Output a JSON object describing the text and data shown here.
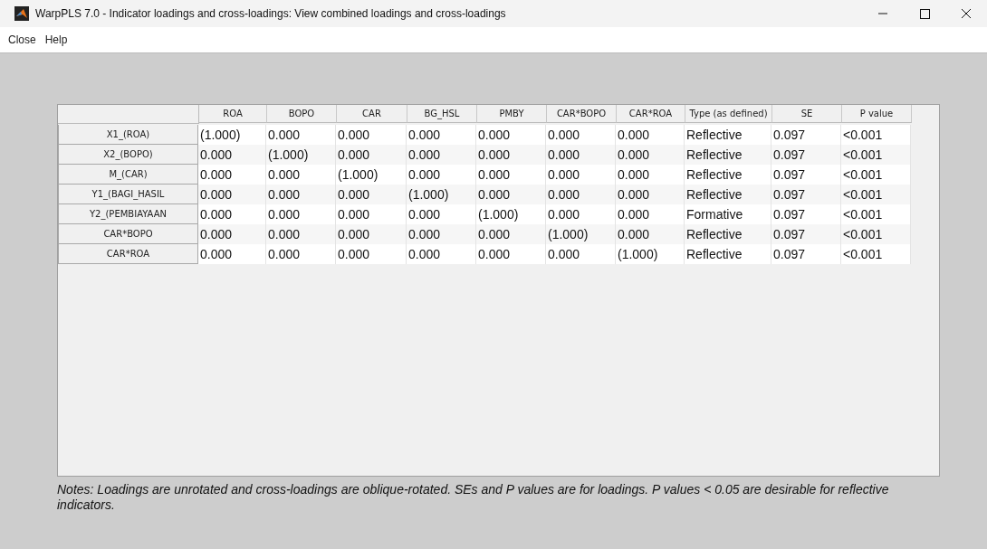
{
  "window": {
    "title": "WarpPLS 7.0 - Indicator loadings and cross-loadings: View combined loadings and cross-loadings"
  },
  "menu": [
    "Close",
    "Help"
  ],
  "table": {
    "columns": [
      "ROA",
      "BOPO",
      "CAR",
      "BG_HSL",
      "PMBY",
      "CAR*BOPO",
      "CAR*ROA",
      "Type (as defined)",
      "SE",
      "P value"
    ],
    "rows": [
      {
        "header": "X1_(ROA)",
        "cells": [
          "(1.000)",
          "0.000",
          "0.000",
          "0.000",
          "0.000",
          "0.000",
          "0.000",
          "Reflective",
          "0.097",
          "<0.001"
        ]
      },
      {
        "header": "X2_(BOPO)",
        "cells": [
          "0.000",
          "(1.000)",
          "0.000",
          "0.000",
          "0.000",
          "0.000",
          "0.000",
          "Reflective",
          "0.097",
          "<0.001"
        ]
      },
      {
        "header": "M_(CAR)",
        "cells": [
          "0.000",
          "0.000",
          "(1.000)",
          "0.000",
          "0.000",
          "0.000",
          "0.000",
          "Reflective",
          "0.097",
          "<0.001"
        ]
      },
      {
        "header": "Y1_(BAGI_HASIL",
        "cells": [
          "0.000",
          "0.000",
          "0.000",
          "(1.000)",
          "0.000",
          "0.000",
          "0.000",
          "Reflective",
          "0.097",
          "<0.001"
        ]
      },
      {
        "header": "Y2_(PEMBIAYAAN",
        "cells": [
          "0.000",
          "0.000",
          "0.000",
          "0.000",
          "(1.000)",
          "0.000",
          "0.000",
          "Formative",
          "0.097",
          "<0.001"
        ]
      },
      {
        "header": "CAR*BOPO",
        "cells": [
          "0.000",
          "0.000",
          "0.000",
          "0.000",
          "0.000",
          "(1.000)",
          "0.000",
          "Reflective",
          "0.097",
          "<0.001"
        ]
      },
      {
        "header": "CAR*ROA",
        "cells": [
          "0.000",
          "0.000",
          "0.000",
          "0.000",
          "0.000",
          "0.000",
          "(1.000)",
          "Reflective",
          "0.097",
          "<0.001"
        ]
      }
    ]
  },
  "notes": "Notes: Loadings are unrotated and cross-loadings are oblique-rotated. SEs and P values are for loadings. P values < 0.05 are desirable for reflective indicators."
}
